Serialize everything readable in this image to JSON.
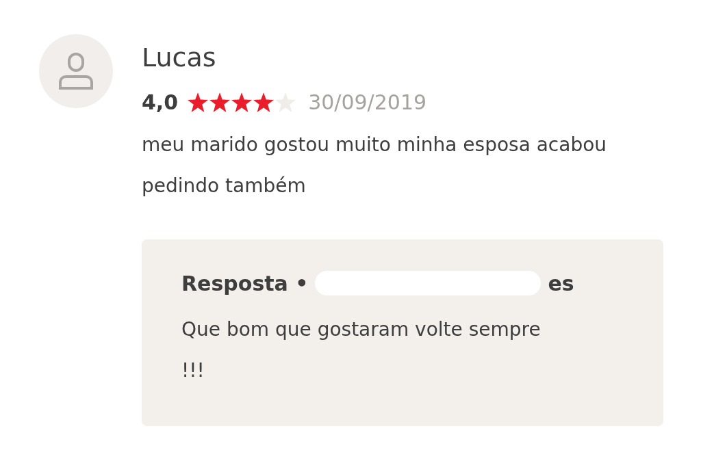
{
  "review": {
    "author": "Lucas",
    "rating": "4,0",
    "stars": 4,
    "date": "30/09/2019",
    "comment": "meu marido gostou muito minha esposa acabou pedindo também"
  },
  "reply": {
    "title_start": "Resposta •",
    "title_end": "es",
    "text": "Que bom que gostaram volte sempre !!!"
  }
}
